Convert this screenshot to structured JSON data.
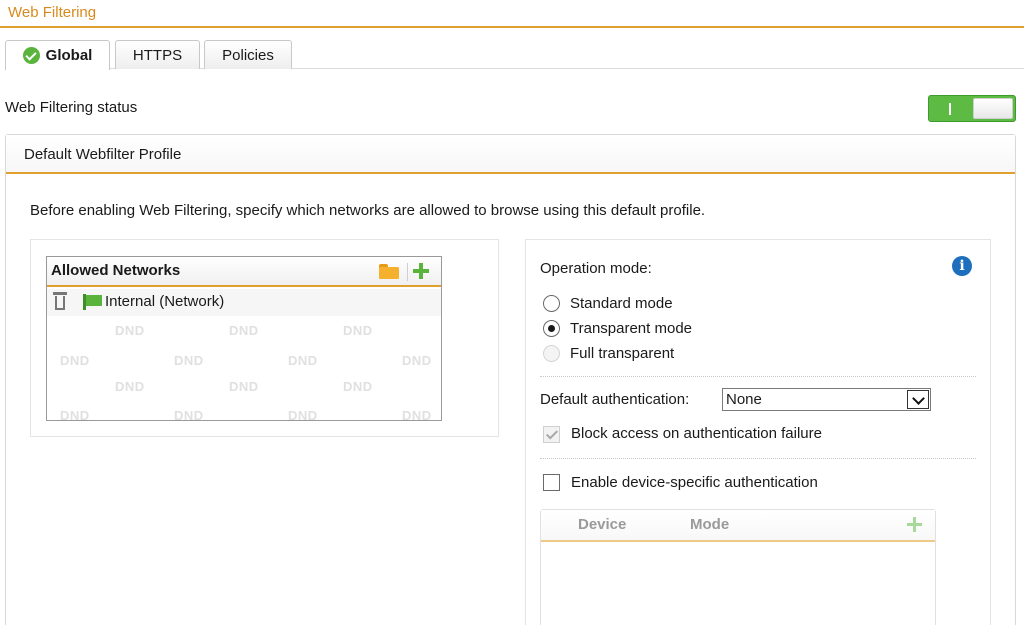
{
  "header": {
    "title": "Web Filtering"
  },
  "tabs": [
    {
      "label": "Global",
      "active": true,
      "icon": "check-circle-icon"
    },
    {
      "label": "HTTPS",
      "active": false
    },
    {
      "label": "Policies",
      "active": false
    }
  ],
  "status": {
    "label": "Web Filtering status",
    "enabled": true
  },
  "profile": {
    "title": "Default Webfilter Profile",
    "instructions": "Before enabling Web Filtering, specify which networks are allowed to browse using this default profile."
  },
  "allowed_networks": {
    "title": "Allowed Networks",
    "items": [
      {
        "name": "Internal (Network)",
        "icon": "network-icon"
      }
    ],
    "dnd_label": "DND"
  },
  "operation": {
    "label": "Operation mode:",
    "options": [
      {
        "label": "Standard mode",
        "checked": false,
        "disabled": false
      },
      {
        "label": "Transparent mode",
        "checked": true,
        "disabled": false
      },
      {
        "label": "Full transparent",
        "checked": false,
        "disabled": true
      }
    ]
  },
  "auth": {
    "label": "Default authentication:",
    "value": "None",
    "block_label": "Block access on authentication failure",
    "block_checked": true,
    "device_label": "Enable device-specific authentication",
    "device_checked": false
  },
  "device_table": {
    "columns": [
      "Device",
      "Mode"
    ]
  },
  "colors": {
    "accent": "#e0a030",
    "header_text": "#d98a1c",
    "toggle_on": "#5dbb44",
    "info": "#1d6fbd"
  }
}
